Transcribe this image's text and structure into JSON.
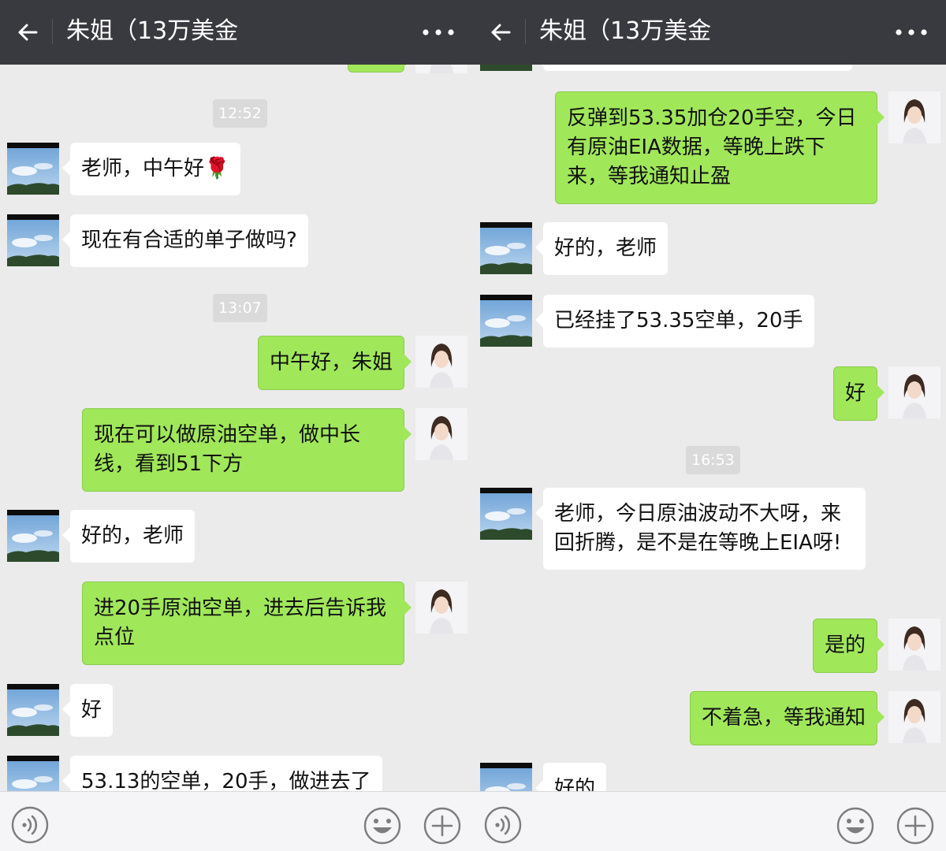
{
  "left": {
    "header": {
      "title": "朱姐（13万美金"
    },
    "timestamps": [
      "12:52",
      "13:07"
    ],
    "messages": [
      {
        "text": "老师，中午好🌹"
      },
      {
        "text": "现在有合适的单子做吗?"
      },
      {
        "text": "中午好，朱姐"
      },
      {
        "text": "现在可以做原油空单，做中长线，看到51下方"
      },
      {
        "text": "好的，老师"
      },
      {
        "text": "进20手原油空单，进去后告诉我点位"
      },
      {
        "text": "好"
      },
      {
        "text": "53.13的空单，20手，做进去了"
      }
    ]
  },
  "right": {
    "header": {
      "title": "朱姐（13万美金"
    },
    "timestamps": [
      "16:53"
    ],
    "messages": [
      {
        "text": "反弹到53.35加仓20手空，今日有原油EIA数据，等晚上跌下来，等我通知止盈"
      },
      {
        "text": "好的，老师"
      },
      {
        "text": "已经挂了53.35空单，20手"
      },
      {
        "text": "好"
      },
      {
        "text": "老师，今日原油波动不大呀，来回折腾，是不是在等晚上EIA呀!"
      },
      {
        "text": "是的"
      },
      {
        "text": "不着急，等我通知"
      },
      {
        "text": "好的"
      }
    ]
  },
  "colors": {
    "header_bg": "#393a3f",
    "chat_bg": "#ebebeb",
    "outgoing_bubble": "#a0e75a",
    "incoming_bubble": "#ffffff",
    "timestamp_bg": "#dadada"
  },
  "icons": {
    "back": "back-arrow-icon",
    "more": "more-dots-icon",
    "voice": "voice-icon",
    "emoji": "emoji-icon",
    "plus": "plus-icon"
  }
}
